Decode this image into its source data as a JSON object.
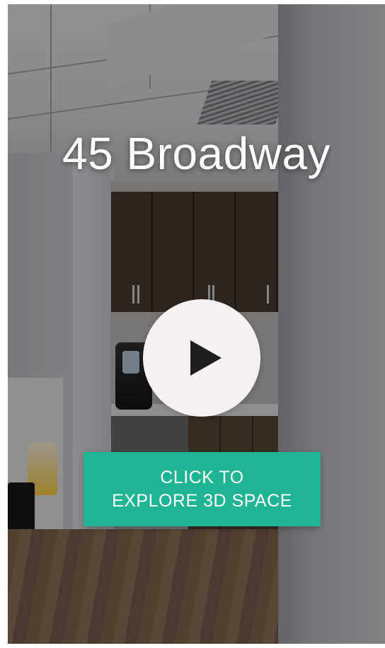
{
  "tour": {
    "title": "45 Broadway",
    "play_icon": "play-icon",
    "cta": {
      "line1": "CLICK TO",
      "line2": "EXPLORE 3D SPACE",
      "color": "#1fb592"
    }
  }
}
